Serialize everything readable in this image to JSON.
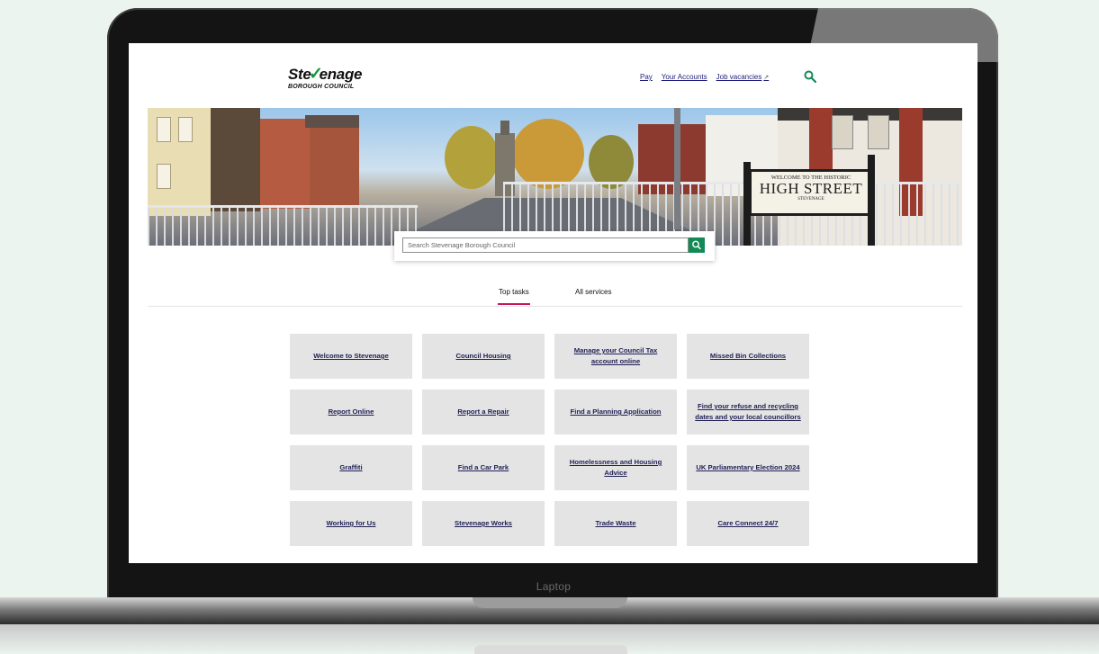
{
  "device": {
    "label": "Laptop"
  },
  "site": {
    "logo": {
      "word_prefix": "Ste",
      "word_suffix": "enage",
      "subtitle": "BOROUGH COUNCIL"
    },
    "nav": {
      "pay": "Pay",
      "accounts": "Your Accounts",
      "jobs": "Job vacancies"
    },
    "hero_sign": {
      "line1": "WELCOME TO THE HISTORIC",
      "line2": "HIGH STREET",
      "line3": "STEVENAGE"
    },
    "search": {
      "placeholder": "Search Stevenage Borough Council"
    },
    "tabs": {
      "top_tasks": "Top tasks",
      "all_services": "All services"
    },
    "tiles": [
      "Welcome to Stevenage",
      "Council Housing",
      "Manage your Council Tax account online",
      "Missed Bin Collections",
      "Report Online",
      "Report a Repair",
      "Find a Planning Application",
      "Find your refuse and recycling dates and your local councillors",
      "Graffiti",
      "Find a Car Park",
      "Homelessness and Housing Advice",
      "UK Parliamentary Election 2024",
      "Working for Us",
      "Stevenage Works",
      "Trade Waste",
      "Care Connect 24/7"
    ],
    "colors": {
      "accent_green": "#138a55",
      "tab_underline": "#c2185b",
      "tile_bg": "#e4e4e4"
    }
  }
}
